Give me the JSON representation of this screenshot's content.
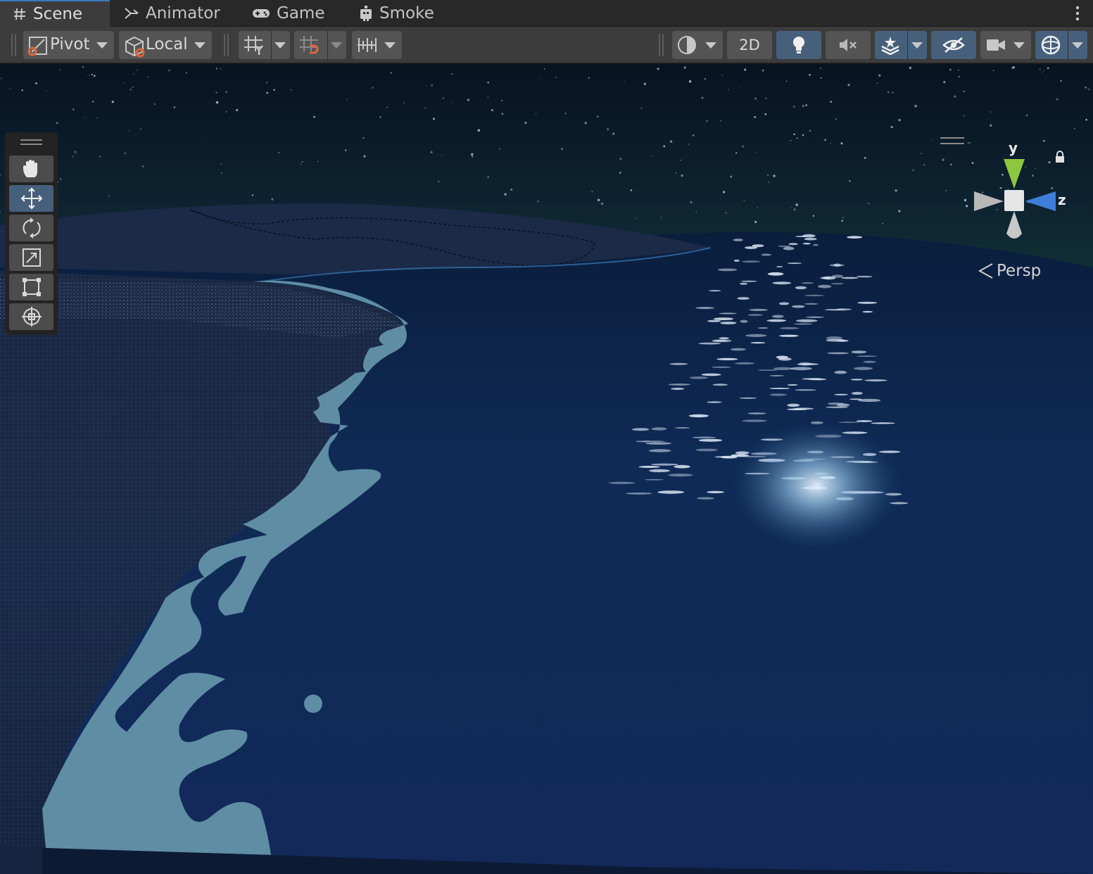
{
  "tabs": [
    {
      "label": "Scene",
      "icon": "grid-hash-icon",
      "active": true
    },
    {
      "label": "Animator",
      "icon": "animator-icon",
      "active": false
    },
    {
      "label": "Game",
      "icon": "gamepad-icon",
      "active": false
    },
    {
      "label": "Smoke",
      "icon": "smoke-icon",
      "active": false
    }
  ],
  "toolbar": {
    "pivot_label": "Pivot",
    "local_label": "Local",
    "mode_2d_label": "2D"
  },
  "tools": [
    {
      "name": "hand-tool",
      "icon": "hand-icon",
      "active": false
    },
    {
      "name": "move-tool",
      "icon": "move-arrows-icon",
      "active": true
    },
    {
      "name": "rotate-tool",
      "icon": "rotate-icon",
      "active": false
    },
    {
      "name": "scale-tool",
      "icon": "scale-icon",
      "active": false
    },
    {
      "name": "rect-tool",
      "icon": "rect-transform-icon",
      "active": false
    },
    {
      "name": "transform-tool",
      "icon": "transform-icon",
      "active": false
    }
  ],
  "gizmo": {
    "y_label": "y",
    "z_label": "z",
    "projection_label": "Persp"
  },
  "colors": {
    "accent_blue": "#46607c",
    "active_tab_line": "#3a79bb",
    "water_deep": "#10285a",
    "foam": "#5f8da4",
    "sand": "#1c2a45",
    "sky": "#0a1622",
    "gizmo_y": "#8dc63f",
    "gizmo_z": "#3d7ed8"
  }
}
